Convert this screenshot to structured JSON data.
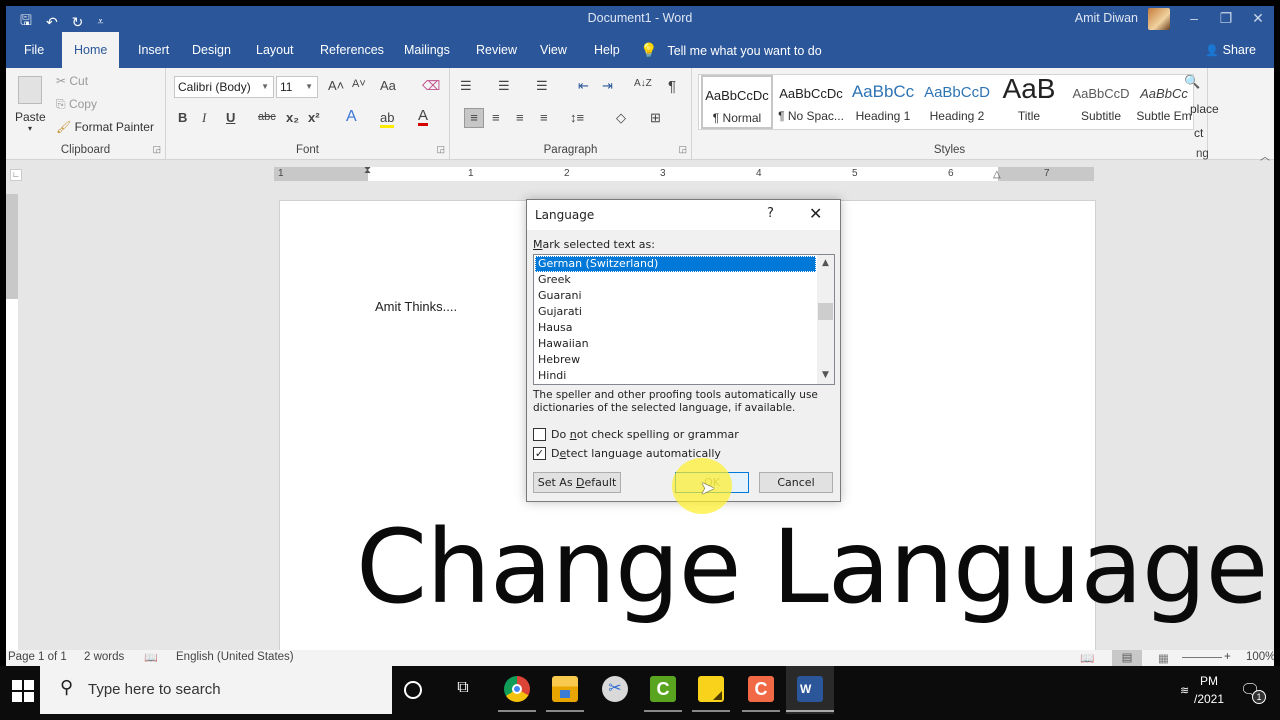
{
  "window": {
    "title": "Document1  -  Word",
    "user_name": "Amit Diwan",
    "controls": {
      "minimize": "–",
      "restore": "❐",
      "close": "✕"
    }
  },
  "quick_access": {
    "save": "🖫",
    "undo": "↶",
    "undo_dropdown": "▾",
    "redo": "↻",
    "customize": "⩡"
  },
  "tabs": [
    "File",
    "Home",
    "Insert",
    "Design",
    "Layout",
    "References",
    "Mailings",
    "Review",
    "View",
    "Help"
  ],
  "active_tab": "Home",
  "tell_me": {
    "icon": "💡",
    "label": "Tell me what you want to do"
  },
  "share": {
    "icon": "👤",
    "label": "Share"
  },
  "ribbon": {
    "clipboard": {
      "label": "Clipboard",
      "paste": "Paste",
      "cut": "Cut",
      "copy": "Copy",
      "format_painter": "Format Painter"
    },
    "font": {
      "label": "Font",
      "font_name": "Calibri (Body)",
      "font_size": "11",
      "grow": "A˄",
      "shrink": "A˅",
      "change_case": "Aa",
      "clear": "⌫",
      "bold": "B",
      "italic": "I",
      "underline": "U",
      "strike": "abc",
      "subscript": "x₂",
      "superscript": "x²",
      "text_effects": "A",
      "highlight": "ab",
      "font_color": "A"
    },
    "paragraph": {
      "label": "Paragraph",
      "bullets": "☰",
      "numbering": "☰",
      "multilevel": "☰",
      "decrease_indent": "⇤",
      "increase_indent": "⇥",
      "sort": "A↓Z",
      "show_marks": "¶",
      "align_left": "≡",
      "center": "≡",
      "align_right": "≡",
      "justify": "≡",
      "line_spacing": "↕≡",
      "shading": "◇",
      "borders": "⊞"
    },
    "styles": {
      "label": "Styles",
      "items": [
        {
          "preview": "AaBbCcDc",
          "name": "¶ Normal"
        },
        {
          "preview": "AaBbCcDc",
          "name": "¶ No Spac..."
        },
        {
          "preview": "AaBbCc",
          "name": "Heading 1"
        },
        {
          "preview": "AaBbCcD",
          "name": "Heading 2"
        },
        {
          "preview": "AaB",
          "name": "Title"
        },
        {
          "preview": "AaBbCcD",
          "name": "Subtitle"
        },
        {
          "preview": "AaBbCc",
          "name": "Subtle Em"
        }
      ]
    },
    "editing": {
      "label": "ng",
      "find": "🔍",
      "replace": "place",
      "select": "ct"
    }
  },
  "ruler": {
    "numbers": [
      "1",
      "1",
      "2",
      "3",
      "4",
      "5",
      "6",
      "7"
    ]
  },
  "document": {
    "text": "Amit Thinks....",
    "overlay_title": "Change Language"
  },
  "dialog": {
    "title": "Language",
    "help": "?",
    "close": "✕",
    "mark_label_prefix": "M",
    "mark_label_rest": "ark selected text as:",
    "languages": [
      "German (Switzerland)",
      "Greek",
      "Guarani",
      "Gujarati",
      "Hausa",
      "Hawaiian",
      "Hebrew",
      "Hindi"
    ],
    "selected_language": "German (Switzerland)",
    "description": "The speller and other proofing tools automatically use dictionaries of the selected language, if available.",
    "no_check": {
      "pre": "Do ",
      "u": "n",
      "post": "ot check spelling or grammar",
      "checked": false
    },
    "detect_auto": {
      "pre": "D",
      "u": "e",
      "post": "tect language automatically",
      "checked": true
    },
    "set_default": {
      "pre": "Set As ",
      "u": "D",
      "post": "efault"
    },
    "ok": "OK",
    "cancel": "Cancel"
  },
  "status_bar": {
    "page": "Page 1 of 1",
    "words": "2 words",
    "proofing_icon": "📖",
    "language": "English (United States)",
    "zoom_minus": "–",
    "zoom_plus": "+",
    "zoom": "100%"
  },
  "taskbar": {
    "search_placeholder": "Type here to search",
    "apps": [
      {
        "name": "cortana",
        "color": "#ffffff"
      },
      {
        "name": "task-view",
        "color": "#ffffff"
      },
      {
        "name": "chrome",
        "color": "#dd4b39"
      },
      {
        "name": "file-explorer",
        "color": "#f3c13a"
      },
      {
        "name": "snipping-tool",
        "color": "#9ab"
      },
      {
        "name": "camtasia-green",
        "color": "#5aa520"
      },
      {
        "name": "sticky-notes",
        "color": "#f9d21b"
      },
      {
        "name": "camtasia-orange",
        "color": "#f26a45"
      },
      {
        "name": "word",
        "color": "#2b579a"
      }
    ],
    "time": "PM",
    "date": "/2021",
    "notifications": "1"
  }
}
